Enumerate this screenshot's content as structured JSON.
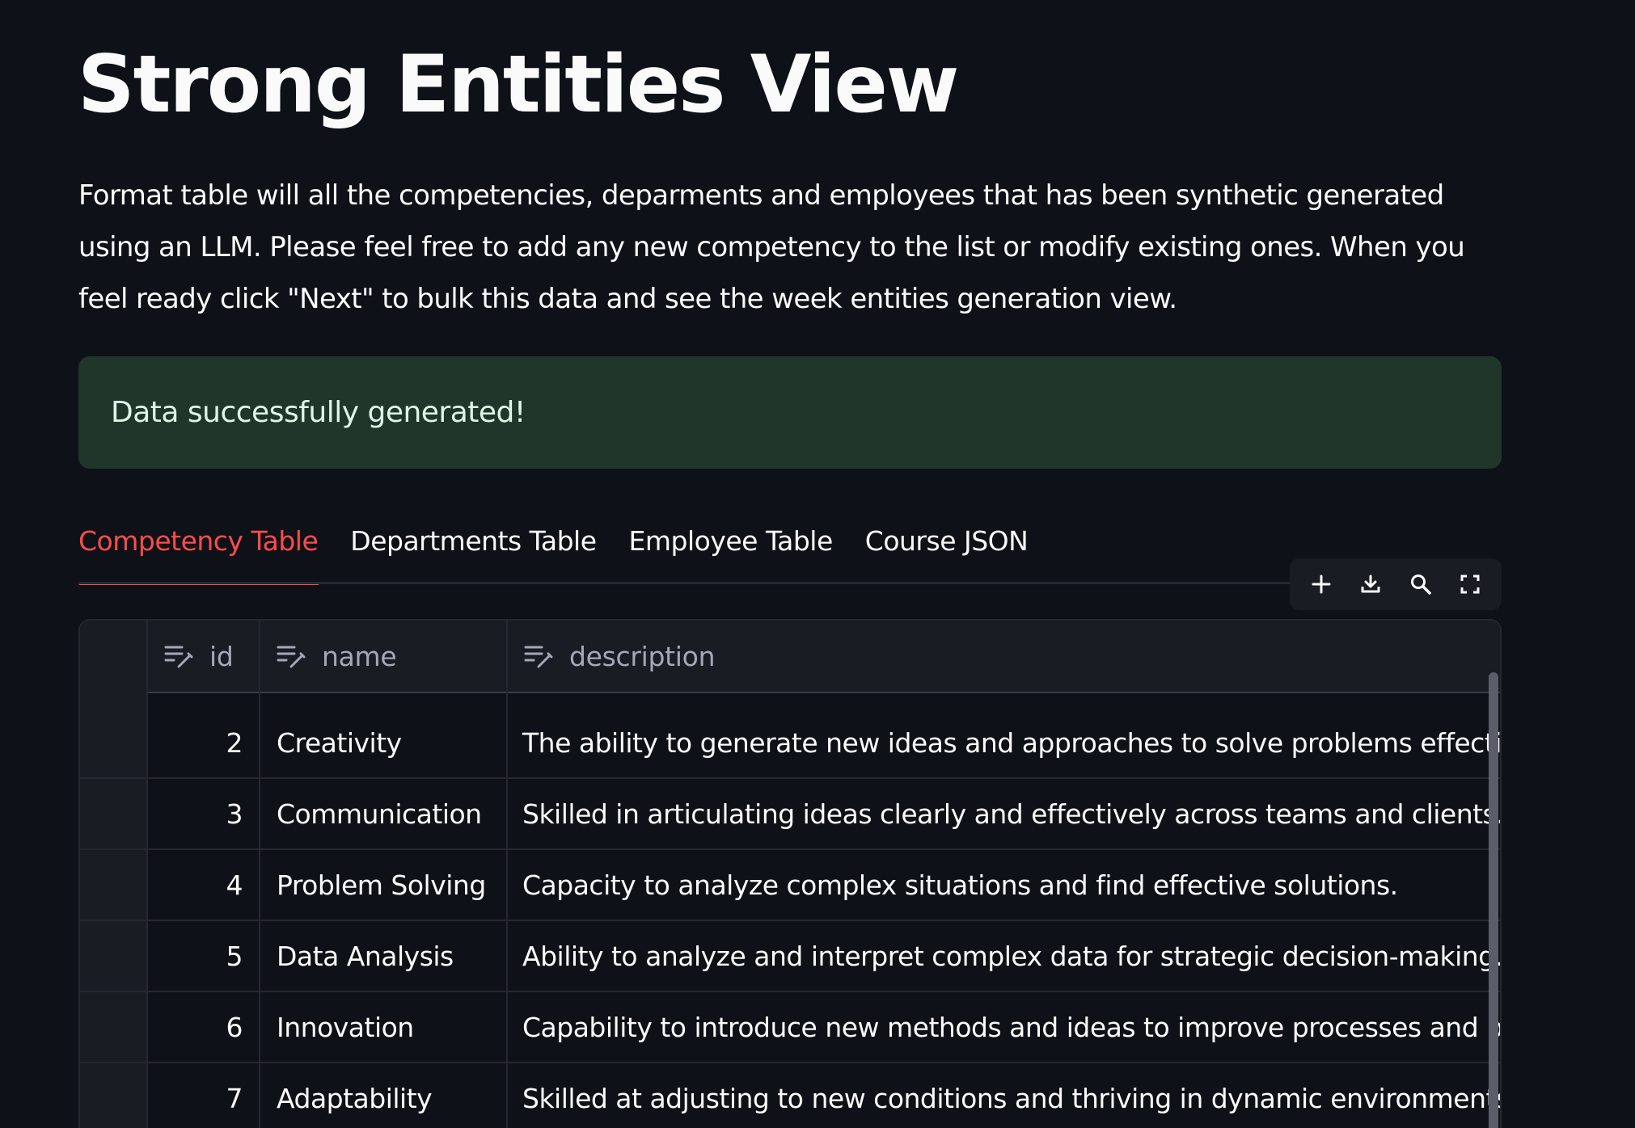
{
  "page": {
    "title": "Strong Entities View",
    "intro": "Format table will all the competencies, deparments and employees that has been synthetic generated using an LLM. Please feel free to add any new competency to the list or modify existing ones. When you feel ready click \"Next\" to bulk this data and see the week entities generation view."
  },
  "alert": {
    "text": "Data successfully generated!",
    "color": "#21362b"
  },
  "tabs": [
    {
      "label": "Competency Table",
      "active": true
    },
    {
      "label": "Departments Table",
      "active": false
    },
    {
      "label": "Employee Table",
      "active": false
    },
    {
      "label": "Course JSON",
      "active": false
    }
  ],
  "toolbar": {
    "icons": [
      "add-row-icon",
      "download-icon",
      "search-icon",
      "fullscreen-icon"
    ]
  },
  "table": {
    "columns": [
      {
        "label": "id",
        "icon": "edit-column-icon"
      },
      {
        "label": "name",
        "icon": "edit-column-icon"
      },
      {
        "label": "description",
        "icon": "edit-column-icon"
      }
    ],
    "rows": [
      {
        "id": "2",
        "name": "Creativity",
        "description": "The ability to generate new ideas and approaches to solve problems effectively."
      },
      {
        "id": "3",
        "name": "Communication",
        "description": "Skilled in articulating ideas clearly and effectively across teams and clients."
      },
      {
        "id": "4",
        "name": "Problem Solving",
        "description": "Capacity to analyze complex situations and find effective solutions."
      },
      {
        "id": "5",
        "name": "Data Analysis",
        "description": "Ability to analyze and interpret complex data for strategic decision-making."
      },
      {
        "id": "6",
        "name": "Innovation",
        "description": "Capability to introduce new methods and ideas to improve processes and products."
      },
      {
        "id": "7",
        "name": "Adaptability",
        "description": "Skilled at adjusting to new conditions and thriving in dynamic environments."
      }
    ]
  },
  "colors": {
    "background": "#0e1117",
    "accent": "#ff4b4b",
    "success_bg": "#21362b",
    "grid_header": "#1a1c24"
  }
}
